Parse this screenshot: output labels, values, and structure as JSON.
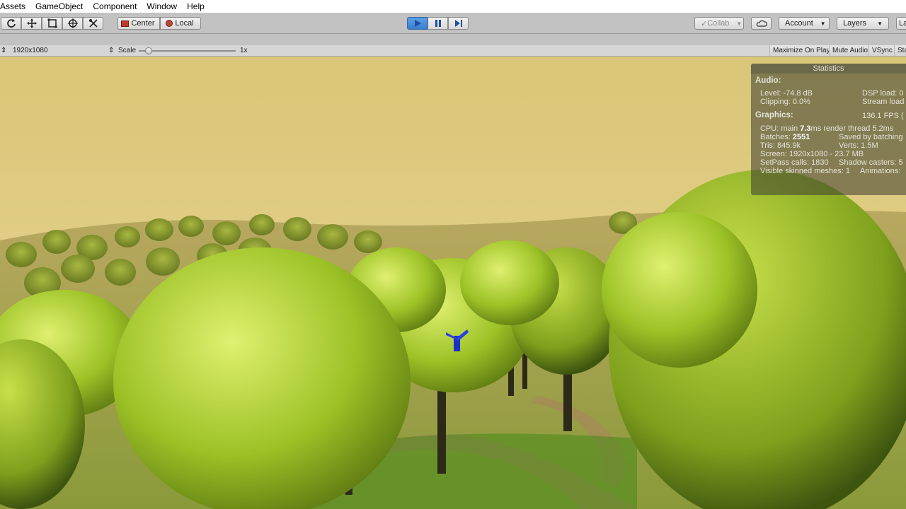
{
  "menubar": {
    "items": [
      "Assets",
      "GameObject",
      "Component",
      "Window",
      "Help"
    ]
  },
  "toolbar": {
    "tools": [
      {
        "name": "hand-tool-icon"
      },
      {
        "name": "move-tool-icon"
      },
      {
        "name": "rect-tool-icon"
      },
      {
        "name": "transform-tool-icon"
      },
      {
        "name": "custom-tool-icon"
      }
    ],
    "pivot_center": "Center",
    "pivot_local": "Local",
    "collab": "Collab",
    "account": "Account",
    "layers": "Layers",
    "layout_partial": "La",
    "accent": "#3a7fd0"
  },
  "gamebar": {
    "resolution": "1920x1080",
    "scale_label": "Scale",
    "scale_value": "1x",
    "scale_fraction": 0.1,
    "maximize": "Maximize On Play",
    "mute": "Mute Audio",
    "vsync": "VSync",
    "stats_partial": "Sta"
  },
  "stats": {
    "title": "Statistics",
    "audio_header": "Audio:",
    "level": "Level: -74.8 dB",
    "clipping": "Clipping: 0.0%",
    "dsp": "DSP load: 0",
    "stream": "Stream load",
    "graphics_header": "Graphics:",
    "fps": "136.1 FPS (",
    "cpu_prefix": "CPU: main ",
    "cpu_main": "7.3",
    "cpu_suffix": "ms  render thread 5.2ms",
    "batches_prefix": "Batches: ",
    "batches_value": "2551",
    "saved": "Saved by batching",
    "tris": "Tris: 845.9k",
    "verts": "Verts: 1.5M",
    "screen": "Screen: 1920x1080 - 23.7 MB",
    "setpass": "SetPass calls: 1830",
    "shadow": "Shadow casters: 5",
    "skinned": "Visible skinned meshes: 1",
    "animations": "Animations:"
  }
}
